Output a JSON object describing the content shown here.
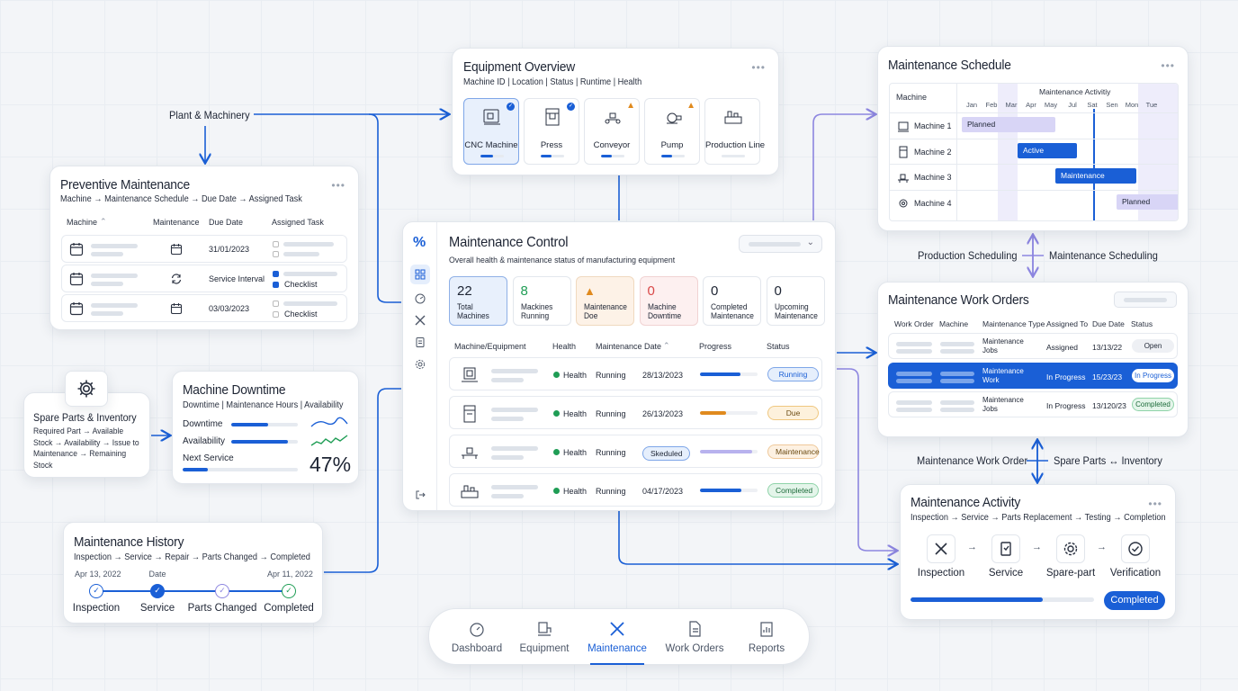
{
  "connectors": {
    "plant": "Plant & Machinery",
    "production_sched": "Production Scheduling",
    "maint_sched": "Maintenance Scheduling",
    "mwo": "Maintenance Work Order",
    "spare_inv": "Spare Parts ↔ Inventory"
  },
  "equipment": {
    "title": "Equipment Overview",
    "sub": "Machine ID | Location | Status | Runtime | Health",
    "items": [
      {
        "name": "CNC Machine",
        "fill": 0.55
      },
      {
        "name": "Press",
        "fill": 0.45
      },
      {
        "name": "Conveyor",
        "fill": 0.45
      },
      {
        "name": "Pump",
        "fill": 0.45
      },
      {
        "name": "Production Line",
        "fill": 0.0
      }
    ]
  },
  "preventive": {
    "title": "Preventive Maintenance",
    "sub": "Machine → Maintenance Schedule → Due Date → Assigned Task",
    "headers": [
      "Machine",
      "Maintenance",
      "Due Date",
      "Assigned Task"
    ],
    "rows": [
      {
        "date": "31/01/2023",
        "task": ""
      },
      {
        "date": "Service Interval",
        "task": "Checklist"
      },
      {
        "date": "03/03/2023",
        "task": "Checklist"
      }
    ]
  },
  "spare": {
    "title": "Spare Parts & Inventory",
    "body": "Required Part → Available Stock → Availability → Issue to Maintenance → Remaining Stock"
  },
  "downtime": {
    "title": "Machine Downtime",
    "sub": "Downtime | Maintenance Hours | Availability",
    "rows": [
      {
        "label": "Downtime",
        "fill": 0.55
      },
      {
        "label": "Availability",
        "fill": 0.85
      },
      {
        "label": "Next Service",
        "fill": 0.22
      }
    ],
    "percent": "47%"
  },
  "history": {
    "title": "Maintenance History",
    "sub": "Inspection → Service → Repair → Parts Changed → Completed",
    "top": [
      "Apr 13, 2022",
      "Date",
      "",
      "Apr 11, 2022"
    ],
    "steps": [
      "Inspection",
      "Service",
      "Parts Changed",
      "Completed"
    ]
  },
  "control": {
    "title": "Maintenance Control",
    "sub": "Overall health & maintenance status of manufacturing equipment",
    "kpis": [
      {
        "num": "22",
        "label": "Total Machines"
      },
      {
        "num": "8",
        "label": "Mackines Running"
      },
      {
        "num": "",
        "label": "Maintenance Doe"
      },
      {
        "num": "0",
        "label": "Machine Downtime"
      },
      {
        "num": "0",
        "label": "Completed Maintenance"
      },
      {
        "num": "0",
        "label": "Upcoming Maintenance"
      }
    ],
    "headers": [
      "Machine/Equipment",
      "Health",
      "Maintenance Date",
      "Progress",
      "Status"
    ],
    "rows": [
      {
        "health": "Health",
        "state": "Running",
        "date": "28/13/2023",
        "progress": 0.7,
        "status": "Running",
        "tag": ""
      },
      {
        "health": "Health",
        "state": "Running",
        "date": "26/13/2023",
        "progress": 0.45,
        "status": "Due",
        "tag": ""
      },
      {
        "health": "Health",
        "state": "Running",
        "date": "",
        "progress": 0.9,
        "status": "Maintenance",
        "tag": "Skeduled"
      },
      {
        "health": "Health",
        "state": "Running",
        "date": "04/17/2023",
        "progress": 0.72,
        "status": "Completed",
        "tag": ""
      }
    ]
  },
  "schedule": {
    "title": "Maintenance Schedule",
    "col": "Machine",
    "activity": "Maintenance Activitiy",
    "months": [
      "Jan",
      "Feb",
      "Mar",
      "Apr",
      "May",
      "Jul",
      "Sat",
      "Sen",
      "Mon",
      "Tue"
    ],
    "machines": [
      "Machine 1",
      "Machine 2",
      "Machine 3",
      "Machine 4"
    ],
    "bars": [
      "Planned",
      "Active",
      "Maintenance",
      "Planned"
    ]
  },
  "workorders": {
    "title": "Maintenance Work Orders",
    "headers": [
      "Work Order",
      "Machine",
      "Maintenance Type",
      "Assigned To",
      "Due Date",
      "Status"
    ],
    "rows": [
      {
        "type": "Maintenance Jobs",
        "assigned": "Assigned",
        "due": "13/13/22",
        "status": "Open"
      },
      {
        "type": "Maintenance Work",
        "assigned": "In Progress",
        "due": "15/23/23",
        "status": "In Progress"
      },
      {
        "type": "Maintenance Jobs",
        "assigned": "In Progress",
        "due": "13/120/23",
        "status": "Completed"
      }
    ]
  },
  "activity": {
    "title": "Maintenance Activity",
    "sub": "Inspection → Service → Parts Replacement → Testing → Completion",
    "steps": [
      "Inspection",
      "Service",
      "Spare-part",
      "Verification"
    ],
    "progress": 0.72,
    "button": "Completed"
  },
  "nav": {
    "items": [
      "Dashboard",
      "Equipment",
      "Maintenance",
      "Work Orders",
      "Reports"
    ],
    "active": 2
  },
  "colors": {
    "accent": "#1a5fd6",
    "green": "#1f9d55",
    "orange": "#e08a1e",
    "red": "#d94848",
    "purple": "#8d86e0"
  }
}
